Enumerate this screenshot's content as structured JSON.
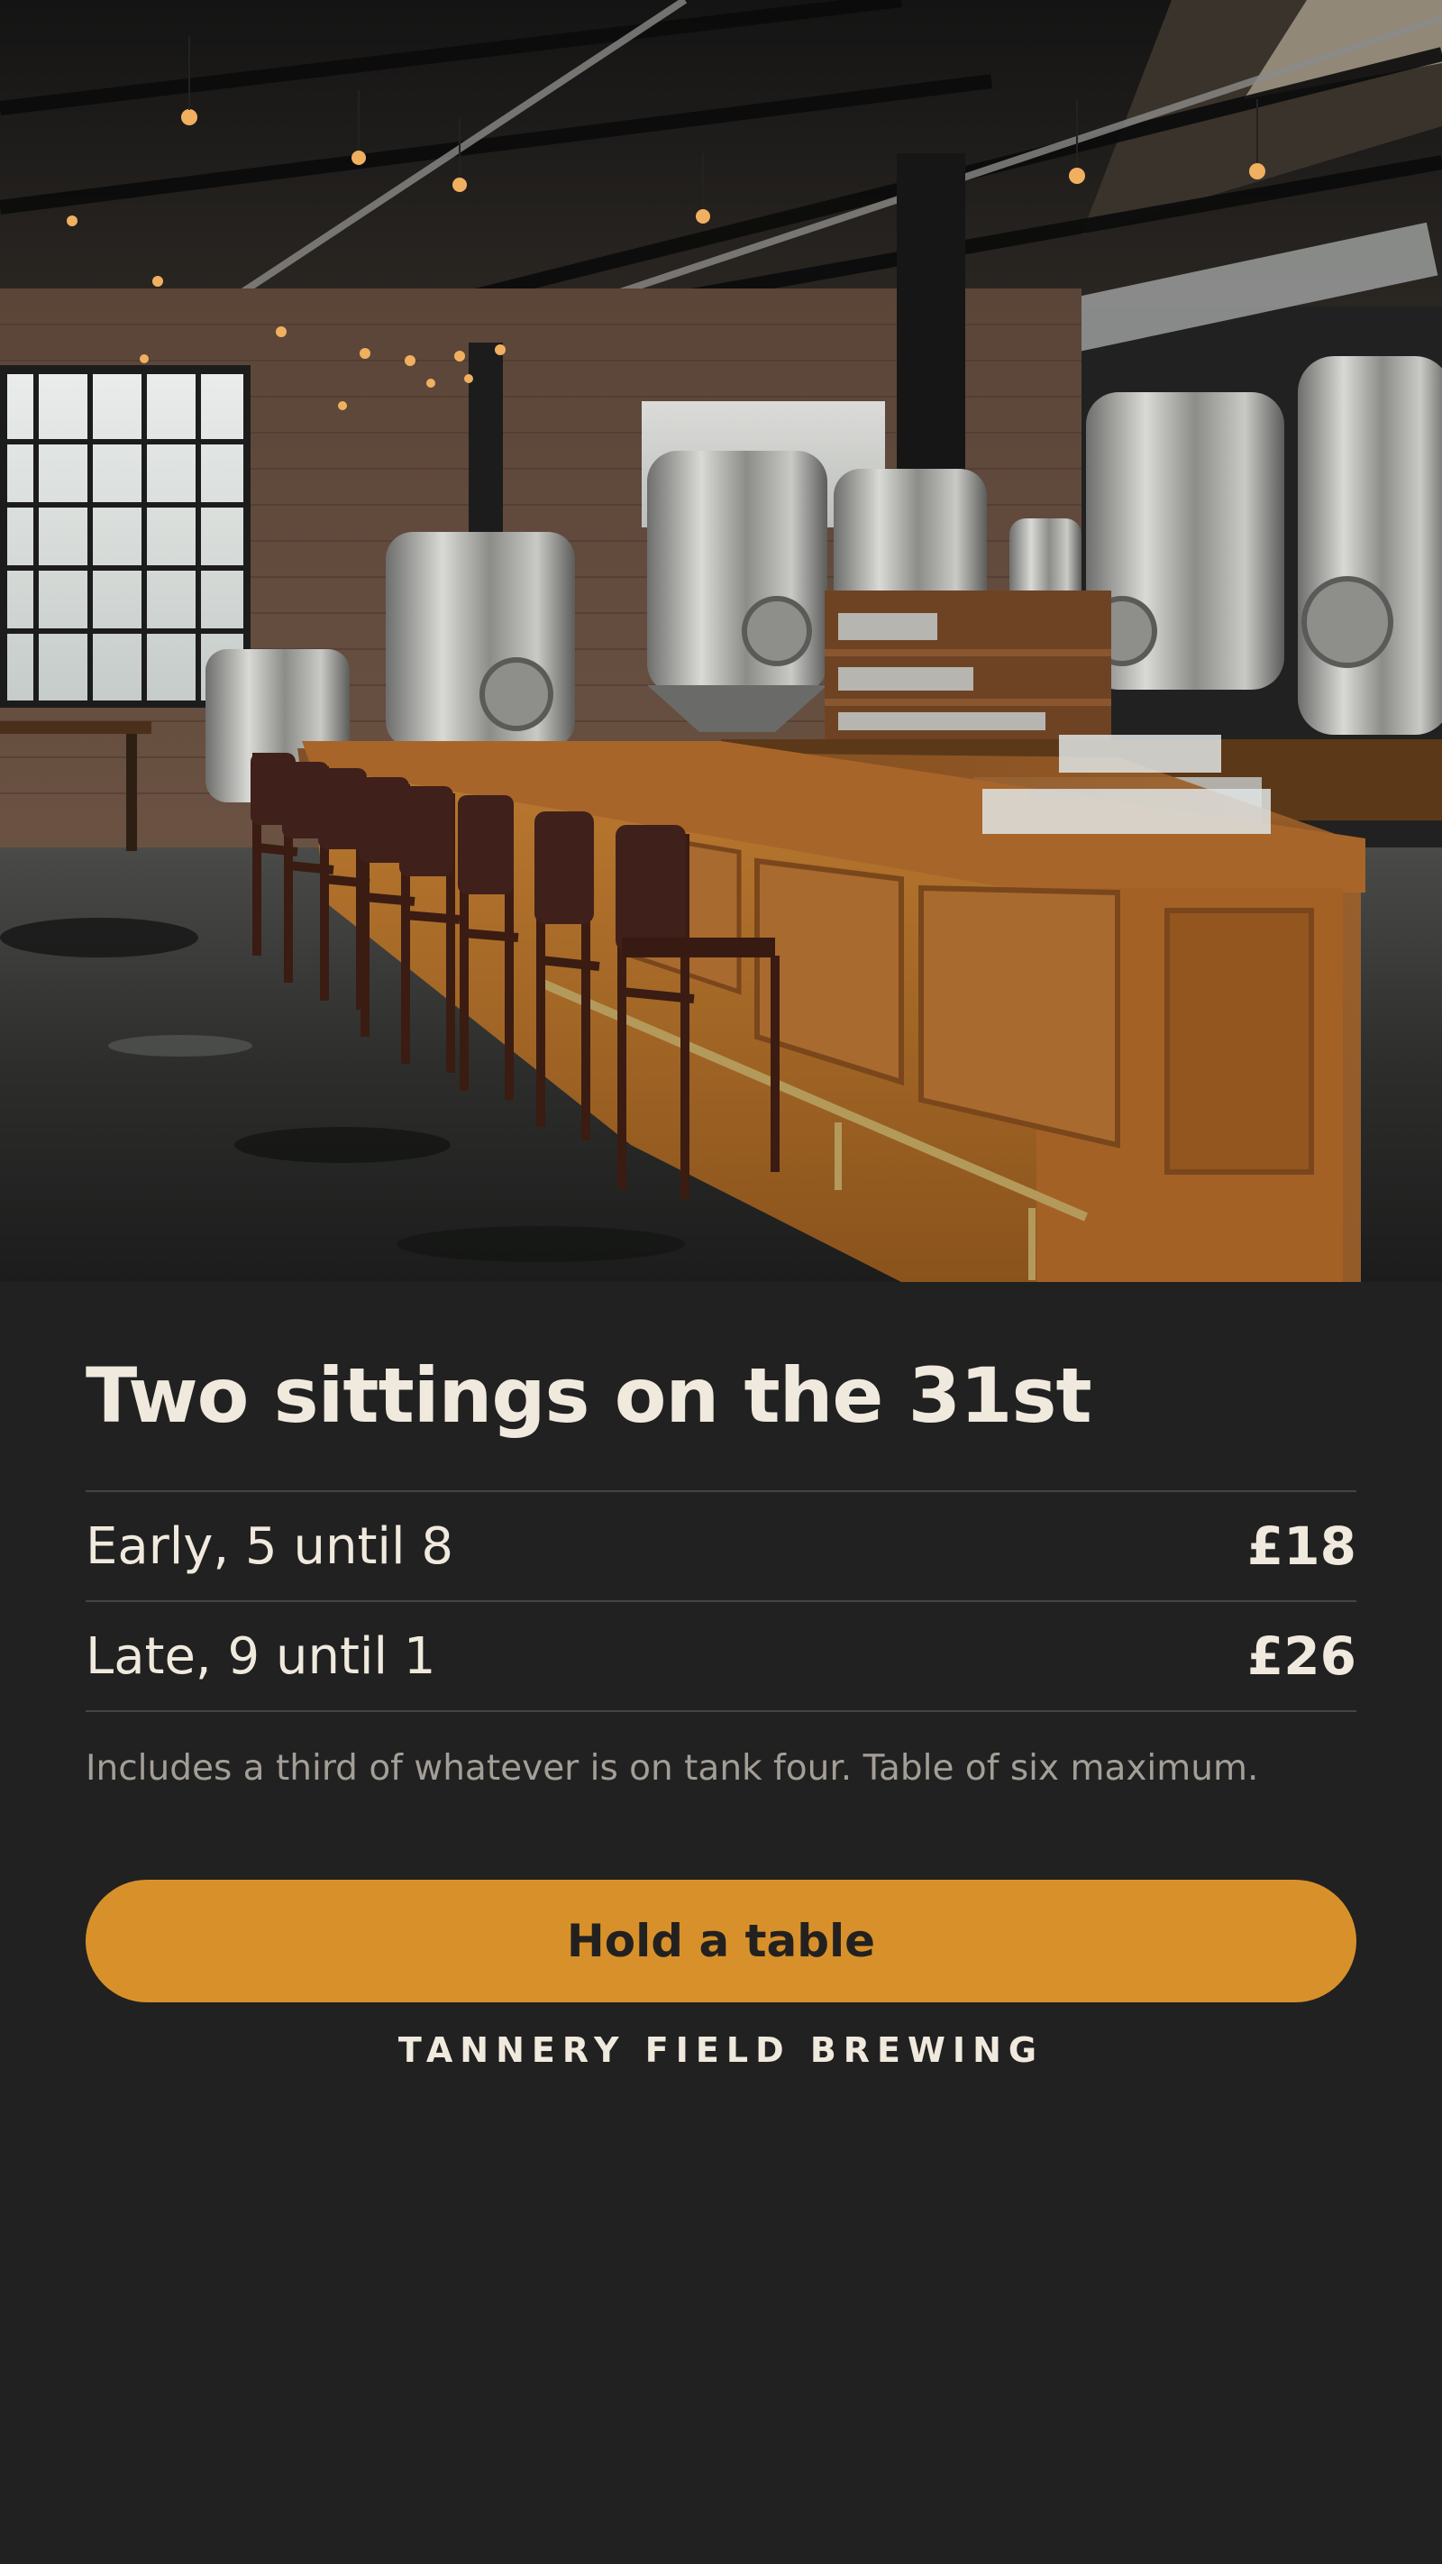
{
  "hero": {
    "image_description": ""
  },
  "offer": {
    "title": "Two sittings on the 31st",
    "sittings": [
      {
        "label": "Early, 5 until 8",
        "price": "£18"
      },
      {
        "label": "Late, 9 until 1",
        "price": "£26"
      }
    ],
    "note": "Includes a third of whatever is on tank four. Table of six maximum.",
    "cta_label": "Hold a table"
  },
  "brand": {
    "name": "TANNERY FIELD BREWING"
  },
  "colors": {
    "background": "#212121",
    "accent": "#d8912a",
    "text": "#f0e9dd",
    "muted_text": "#a39e96",
    "divider": "#454545"
  }
}
